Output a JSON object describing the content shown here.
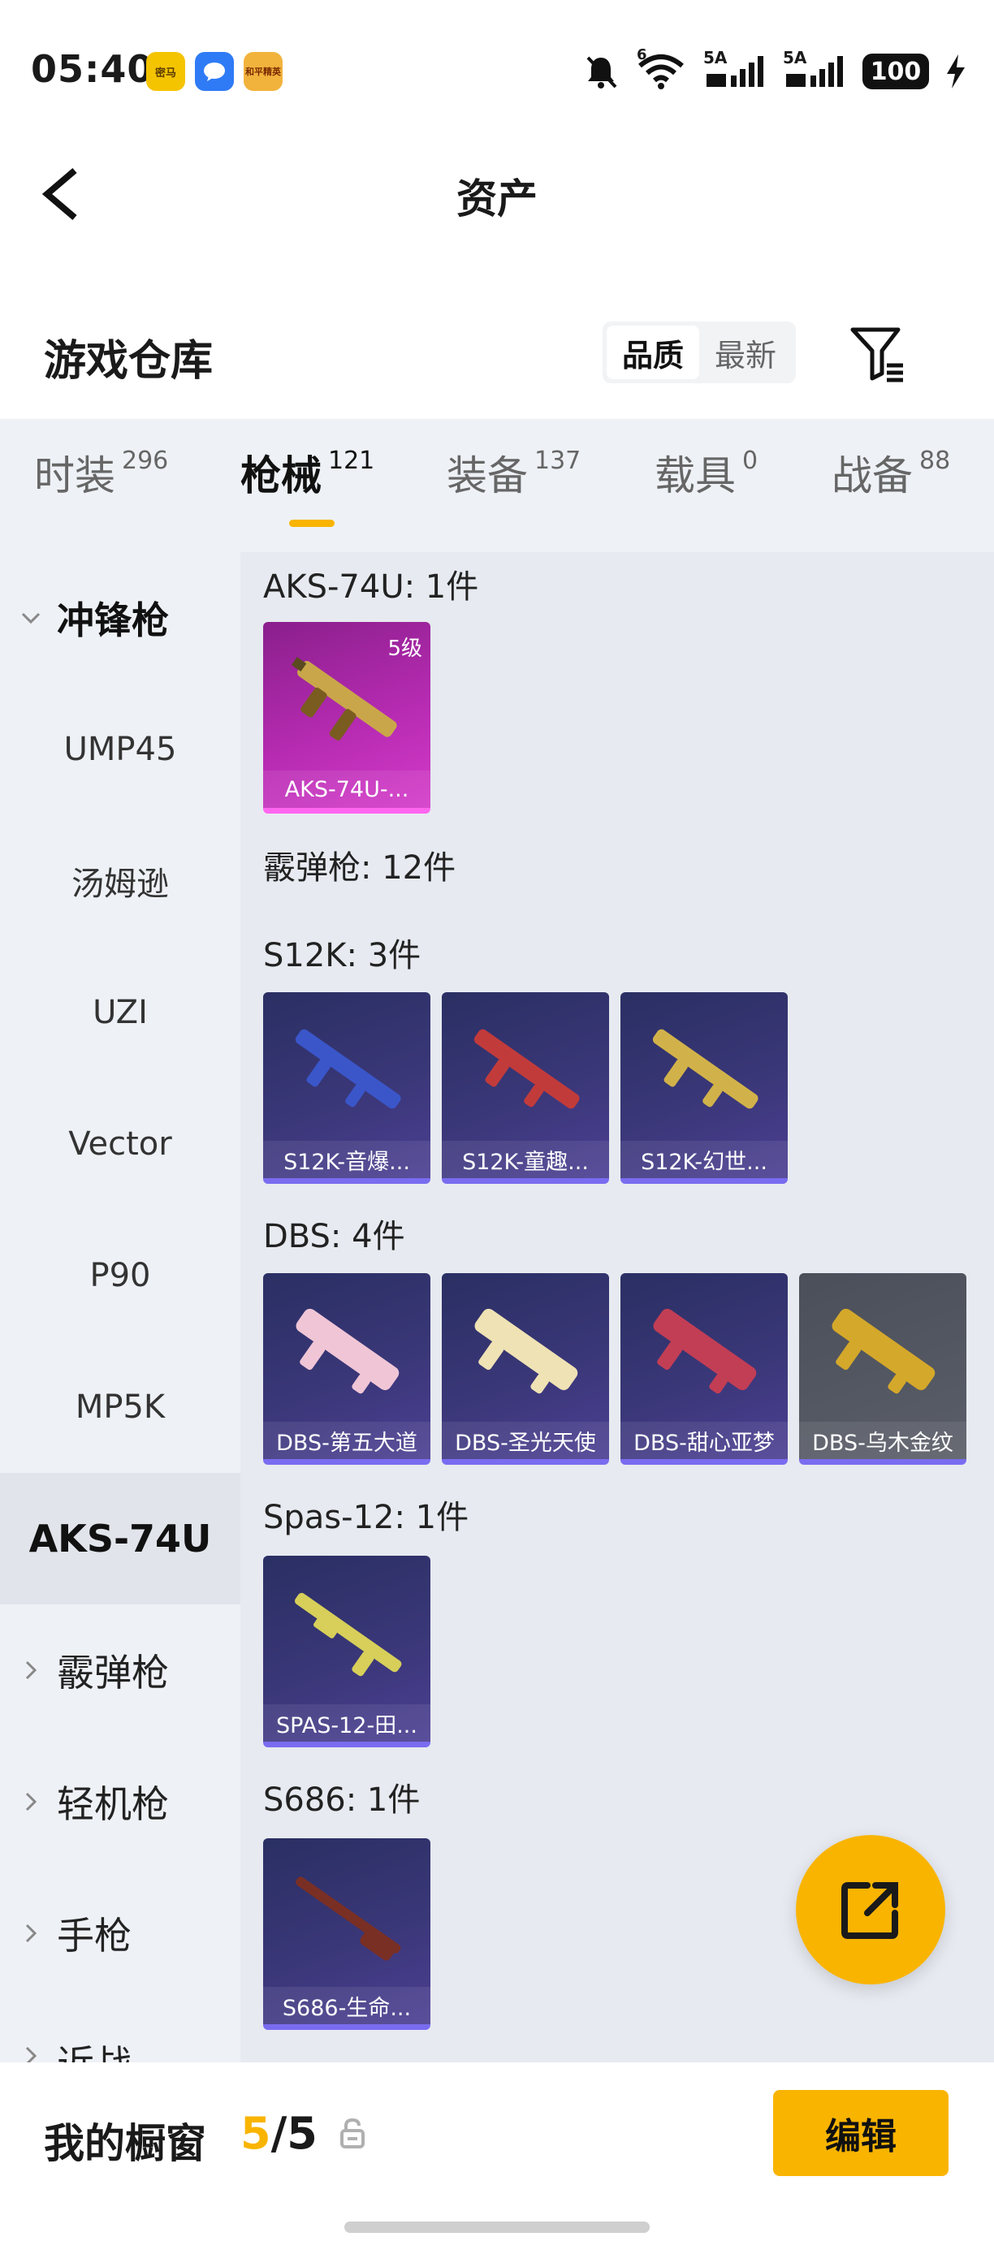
{
  "status_bar": {
    "time": "05:40",
    "apps": [
      {
        "icon": "mima-app-icon",
        "label": "密马",
        "color": "#f5c400"
      },
      {
        "icon": "message-app-icon",
        "label": "",
        "color": "#2f7bf6"
      },
      {
        "icon": "game-app-icon",
        "label": "和平精英",
        "color": "#f2b33d"
      }
    ],
    "battery": "100",
    "network1": "5A",
    "network2": "5A",
    "wifi_badge": "6"
  },
  "header": {
    "title": "资产"
  },
  "warehouse": {
    "title": "游戏仓库",
    "sort_options": [
      "品质",
      "最新"
    ],
    "active_sort": "品质"
  },
  "tabs": [
    {
      "label": "时装",
      "count": "296"
    },
    {
      "label": "枪械",
      "count": "121",
      "active": true
    },
    {
      "label": "装备",
      "count": "137"
    },
    {
      "label": "载具",
      "count": "0"
    },
    {
      "label": "战备",
      "count": "88"
    }
  ],
  "sidebar": {
    "items": [
      {
        "label": "冲锋枪"
      },
      {
        "label": "UMP45"
      },
      {
        "label": "汤姆逊"
      },
      {
        "label": "UZI"
      },
      {
        "label": "Vector"
      },
      {
        "label": "P90"
      },
      {
        "label": "MP5K"
      },
      {
        "label": "AKS-74U"
      },
      {
        "label": "霰弹枪"
      },
      {
        "label": "轻机枪"
      },
      {
        "label": "手枪"
      },
      {
        "label": "近战"
      }
    ]
  },
  "content": {
    "groups": [
      {
        "head": "AKS-74U: 1件"
      },
      {
        "head": "霰弹枪: 12件"
      },
      {
        "head": "S12K: 3件"
      },
      {
        "head": "DBS: 4件"
      },
      {
        "head": "Spas-12: 1件"
      },
      {
        "head": "S686: 1件"
      }
    ],
    "cards": {
      "aks": [
        {
          "name": "AKS-74U-...",
          "level": "5级",
          "rarity": "magenta",
          "gun_color": "#c9a64a"
        }
      ],
      "s12k": [
        {
          "name": "S12K-音爆...",
          "rarity": "purple",
          "gun_color": "#3a56c9"
        },
        {
          "name": "S12K-童趣...",
          "rarity": "purple",
          "gun_color": "#c23b3b"
        },
        {
          "name": "S12K-幻世...",
          "rarity": "purple",
          "gun_color": "#d1b24a"
        }
      ],
      "dbs": [
        {
          "name": "DBS-第五大道",
          "rarity": "purple",
          "gun_color": "#f0c6d6"
        },
        {
          "name": "DBS-圣光天使",
          "rarity": "purple",
          "gun_color": "#efe2b4"
        },
        {
          "name": "DBS-甜心亚梦",
          "rarity": "purple",
          "gun_color": "#c23e55"
        },
        {
          "name": "DBS-乌木金纹",
          "rarity": "gray",
          "gun_color": "#d4a82a"
        }
      ],
      "spas": [
        {
          "name": "SPAS-12-田...",
          "rarity": "purple",
          "gun_color": "#d7cf5a"
        }
      ],
      "s686": [
        {
          "name": "S686-生命...",
          "rarity": "purple",
          "gun_color": "#7a2f24"
        }
      ]
    }
  },
  "showcase": {
    "title": "我的橱窗",
    "current": "5",
    "total": "/5",
    "edit_label": "编辑"
  },
  "colors": {
    "accent": "#f9b400",
    "panel": "#eef1f6",
    "content_bg": "#e7eaf0"
  }
}
